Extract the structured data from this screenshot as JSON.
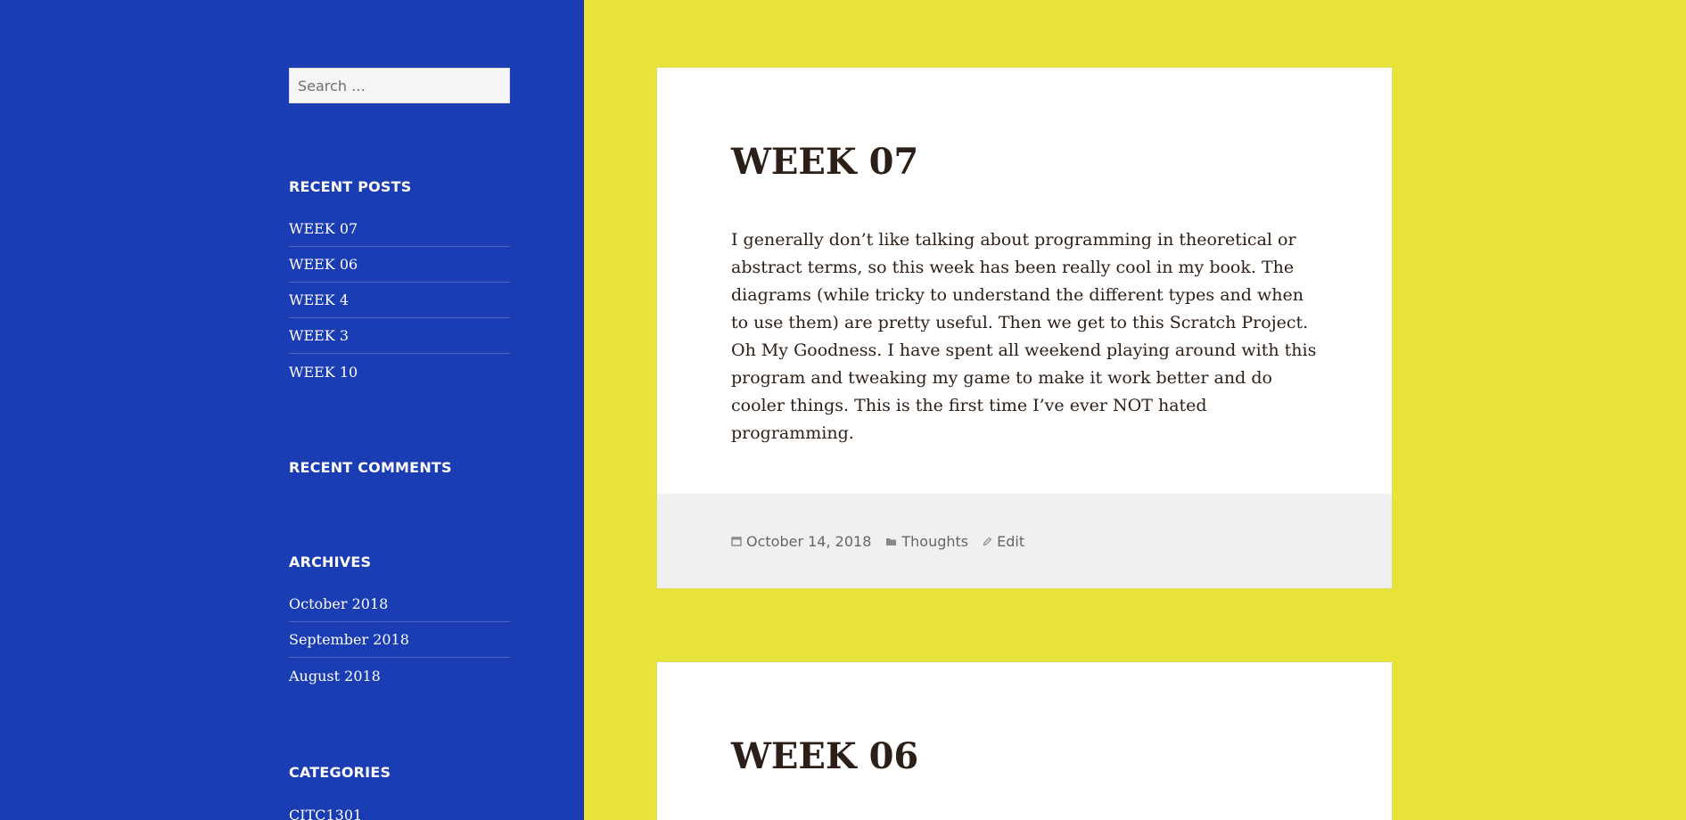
{
  "search": {
    "placeholder": "Search …"
  },
  "recent_posts": {
    "title": "RECENT POSTS",
    "items": [
      "WEEK 07",
      "WEEK 06",
      "WEEK 4",
      "WEEK 3",
      "WEEK 10"
    ]
  },
  "recent_comments": {
    "title": "RECENT COMMENTS"
  },
  "archives": {
    "title": "ARCHIVES",
    "items": [
      "October 2018",
      "September 2018",
      "August 2018"
    ]
  },
  "categories": {
    "title": "CATEGORIES",
    "items": [
      "CITC1301"
    ]
  },
  "posts": [
    {
      "title": "WEEK 07",
      "body": "I generally don’t like talking about programming in theoretical or abstract terms, so this week has been really cool in my book. The diagrams (while tricky to understand the different types and when to use them) are pretty useful. Then we get to this Scratch Project. Oh My Goodness. I have spent all weekend playing around with this program and tweaking my game to make it work better and do cooler things. This is the first time I’ve ever NOT hated programming.",
      "date": "October 14, 2018",
      "category": "Thoughts",
      "edit": "Edit"
    },
    {
      "title": "WEEK 06"
    }
  ],
  "icons": {
    "date": "calendar-icon",
    "category": "folder-icon",
    "edit": "pencil-icon"
  },
  "colors": {
    "sidebar": "#1a3db3",
    "background": "#e8e339",
    "card": "#ffffff",
    "footer": "#f0f0f0",
    "text": "#2c1f17"
  }
}
